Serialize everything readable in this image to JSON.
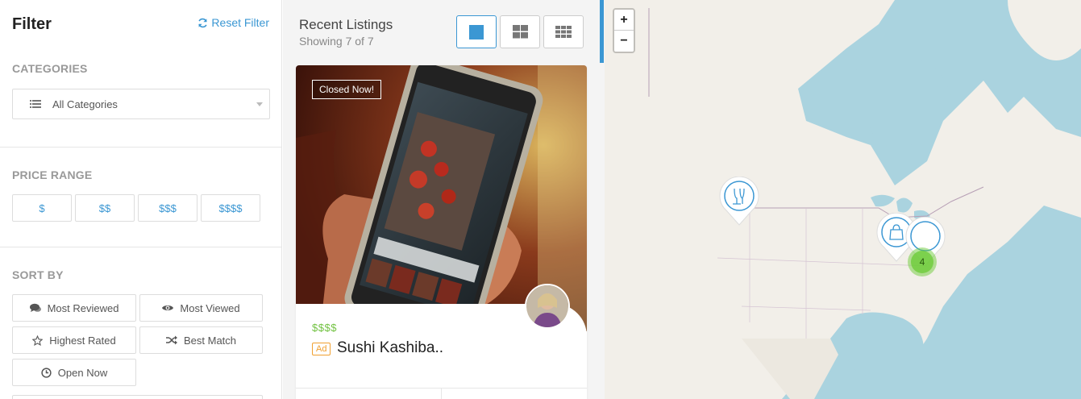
{
  "filter": {
    "title": "Filter",
    "reset_label": "Reset Filter",
    "categories": {
      "label": "CATEGORIES",
      "selected": "All Categories"
    },
    "price_range": {
      "label": "PRICE RANGE",
      "options": [
        "$",
        "$$",
        "$$$",
        "$$$$"
      ]
    },
    "sort_by": {
      "label": "SORT BY",
      "options": [
        {
          "label": "Most Reviewed",
          "icon": "comments-icon"
        },
        {
          "label": "Most Viewed",
          "icon": "eye-icon"
        },
        {
          "label": "Highest Rated",
          "icon": "star-icon"
        },
        {
          "label": "Best Match",
          "icon": "shuffle-icon"
        },
        {
          "label": "Open Now",
          "icon": "clock-icon"
        }
      ]
    }
  },
  "listings": {
    "title": "Recent Listings",
    "count_text": "Showing 7 of 7",
    "view_modes": [
      "list-view-icon",
      "grid-2-icon",
      "grid-3-icon"
    ],
    "active_view": "list-view-icon",
    "cards": [
      {
        "status": "Closed Now!",
        "price": "$$$$",
        "ad_label": "Ad",
        "name": "Sushi Kashiba.."
      }
    ]
  },
  "map": {
    "zoom_in": "+",
    "zoom_out": "−",
    "cluster_count": "4",
    "markers": [
      "restaurant-marker-icon",
      "shopping-bag-marker-icon",
      "circle-marker-icon"
    ]
  },
  "colors": {
    "accent": "#3b97d3",
    "price_green": "#72c242",
    "ad_orange": "#f0a030",
    "map_water": "#aad3df",
    "map_land": "#f2efe9"
  }
}
